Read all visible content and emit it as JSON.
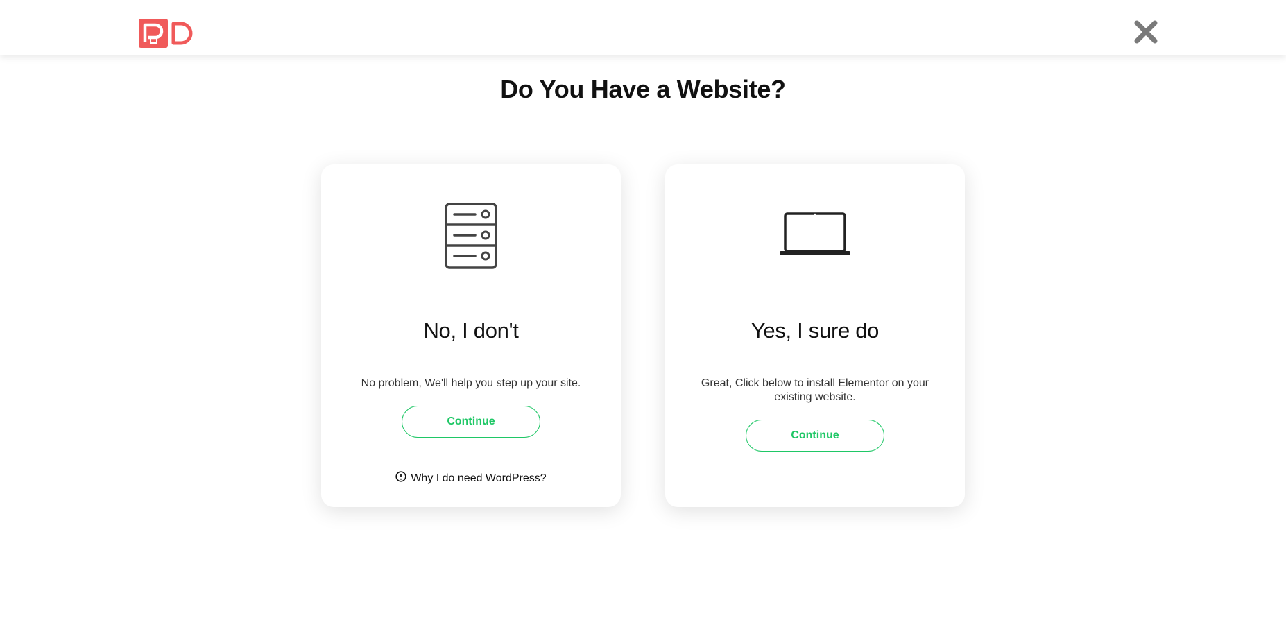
{
  "header": {
    "logo_icon": "pd-logo",
    "close_icon": "close-icon",
    "colors": {
      "logo": "#f05a5a",
      "close": "#7a7a7a"
    }
  },
  "main": {
    "title": "Do You Have a Website?"
  },
  "cards": [
    {
      "icon": "server-icon",
      "heading": "No, I don't",
      "text": "No problem, We'll help you step up your site.",
      "button_label": "Continue",
      "help_link": "Why I do need WordPress?"
    },
    {
      "icon": "laptop-icon",
      "heading": "Yes, I sure do",
      "text": "Great, Click below to install Elementor on your existing website.",
      "button_label": "Continue"
    }
  ],
  "colors": {
    "accent": "#1fc766"
  }
}
